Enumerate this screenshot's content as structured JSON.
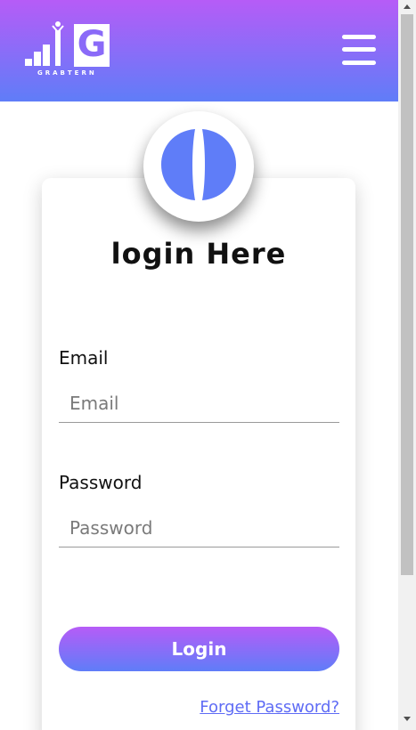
{
  "header": {
    "logo_letter": "G",
    "brand_name": "GRABTERN",
    "gradient_top": "#b65cf7",
    "gradient_bottom": "#5f7df8",
    "menu_icon": "hamburger-menu-icon"
  },
  "login": {
    "avatar_icon": "user-avatar-icon",
    "title": "login Here",
    "email_label": "Email",
    "email_placeholder": "Email",
    "email_value": "",
    "password_label": "Password",
    "password_placeholder": "Password",
    "password_value": "",
    "submit_label": "Login",
    "forgot_link": "Forget Password?"
  },
  "colors": {
    "accent": "#5f7df8",
    "link": "#5f6cf5"
  }
}
